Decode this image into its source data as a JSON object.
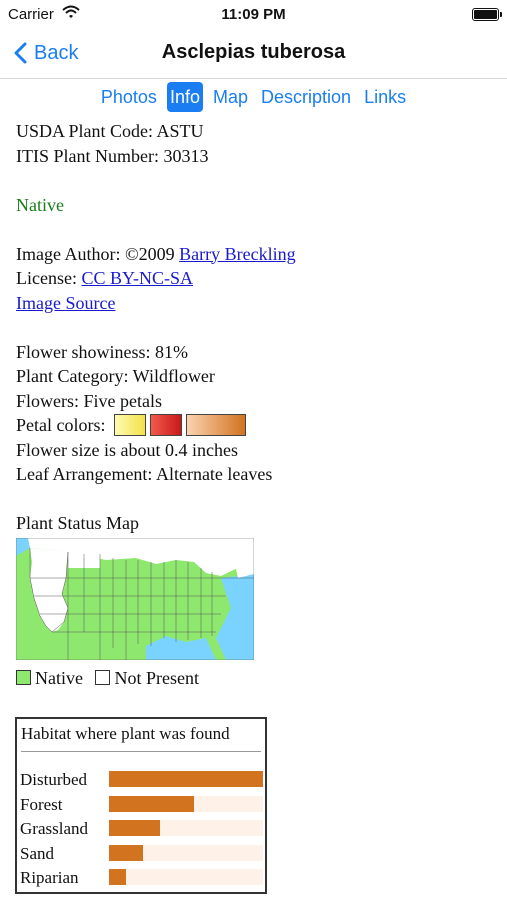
{
  "status_bar": {
    "carrier": "Carrier",
    "time": "11:09 PM"
  },
  "nav": {
    "back_label": "Back",
    "title": "Asclepias tuberosa"
  },
  "tabs": [
    {
      "label": "Photos",
      "active": false
    },
    {
      "label": "Info",
      "active": true
    },
    {
      "label": "Map",
      "active": false
    },
    {
      "label": "Description",
      "active": false
    },
    {
      "label": "Links",
      "active": false
    }
  ],
  "info": {
    "usda_code_label": "USDA Plant Code:",
    "usda_code": "ASTU",
    "itis_label": "ITIS Plant Number:",
    "itis_number": "30313",
    "status": "Native",
    "image_author_label": "Image Author:",
    "image_author_year": "©2009",
    "image_author_name": "Barry Breckling",
    "license_label": "License:",
    "license": "CC BY-NC-SA",
    "image_source": "Image Source",
    "showiness_label": "Flower showiness:",
    "showiness": "81%",
    "category_label": "Plant Category:",
    "category": "Wildflower",
    "flowers_label": "Flowers:",
    "flowers": "Five petals",
    "petal_colors_label": "Petal colors:",
    "petal_colors": [
      {
        "name": "yellow",
        "from": "#fffab0",
        "to": "#f2e14a"
      },
      {
        "name": "red",
        "from": "#f25a4a",
        "to": "#c8191b"
      },
      {
        "name": "orange",
        "from": "#fbd2b0",
        "to": "#d2731f"
      }
    ],
    "flower_size": "Flower size is about 0.4 inches",
    "leaf_label": "Leaf Arrangement:",
    "leaf": "Alternate leaves"
  },
  "map": {
    "title": "Plant Status Map",
    "legend_native": "Native",
    "legend_not_present": "Not Present",
    "native_color": "#8ee86e",
    "not_present_color": "#ffffff"
  },
  "habitat": {
    "title": "Habitat where plant was found",
    "bar_color": "#d2731f",
    "track_color": "#fdf1e8",
    "rows": [
      {
        "label": "Disturbed",
        "value": 1.0
      },
      {
        "label": "Forest",
        "value": 0.55
      },
      {
        "label": "Grassland",
        "value": 0.33
      },
      {
        "label": "Sand",
        "value": 0.22
      },
      {
        "label": "Riparian",
        "value": 0.11
      }
    ]
  }
}
